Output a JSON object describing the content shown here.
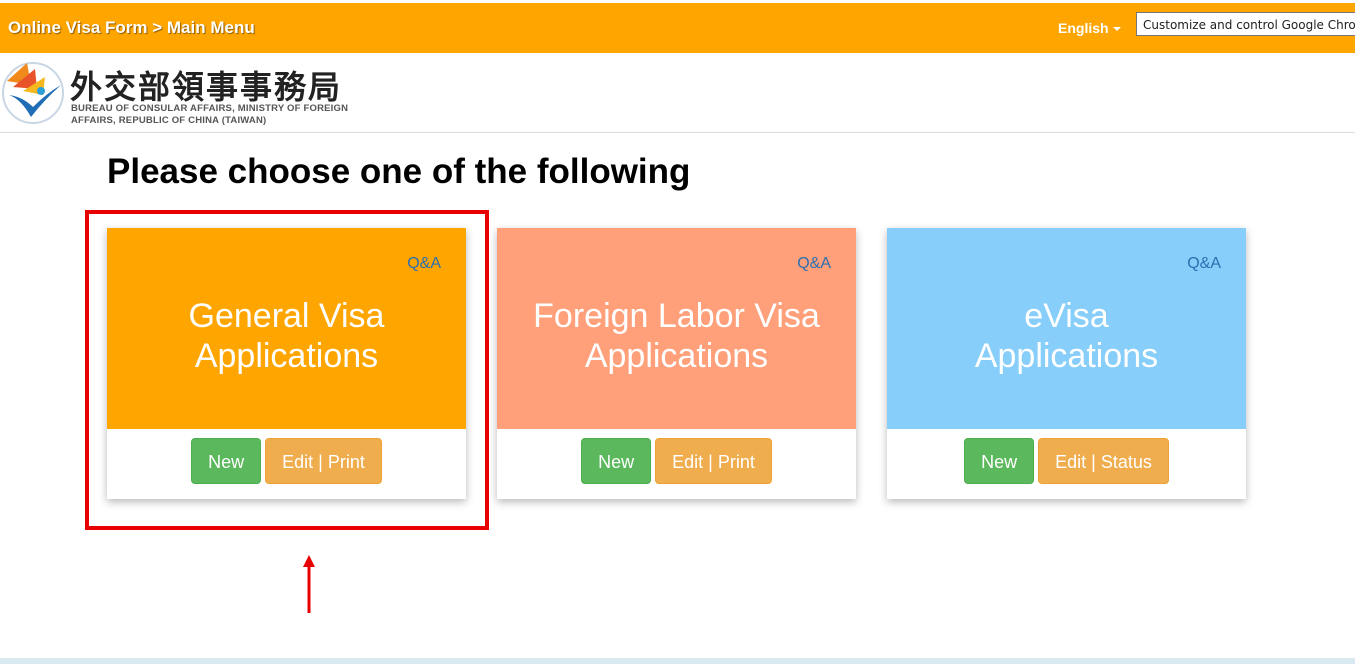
{
  "header": {
    "breadcrumb": "Online Visa Form > Main Menu",
    "language": "English",
    "tooltip": "Customize and control Google Chrome",
    "color": "#ffa500"
  },
  "brand": {
    "name_cn": "外交部領事事務局",
    "name_en": "BUREAU OF CONSULAR AFFAIRS, MINISTRY OF FOREIGN AFFAIRS, REPUBLIC OF CHINA (TAIWAN)",
    "logo_icon": "bureau-logo-icon"
  },
  "main": {
    "heading": "Please choose one of the following",
    "cards": [
      {
        "qa_label": "Q&A",
        "title_line1": "General Visa",
        "title_line2": "Applications",
        "color": "#ffa500",
        "new_label": "New",
        "edit_label": "Edit | Print",
        "highlighted": true
      },
      {
        "qa_label": "Q&A",
        "title_line1": "Foreign Labor Visa",
        "title_line2": "Applications",
        "color": "#ffa07a",
        "new_label": "New",
        "edit_label": "Edit | Print",
        "highlighted": false
      },
      {
        "qa_label": "Q&A",
        "title_line1": "eVisa",
        "title_line2": "Applications",
        "color": "#87cefa",
        "new_label": "New",
        "edit_label": "Edit | Status",
        "highlighted": false
      }
    ]
  },
  "annotation": {
    "highlight_color": "#e80000",
    "arrow_icon": "arrow-up-icon"
  }
}
